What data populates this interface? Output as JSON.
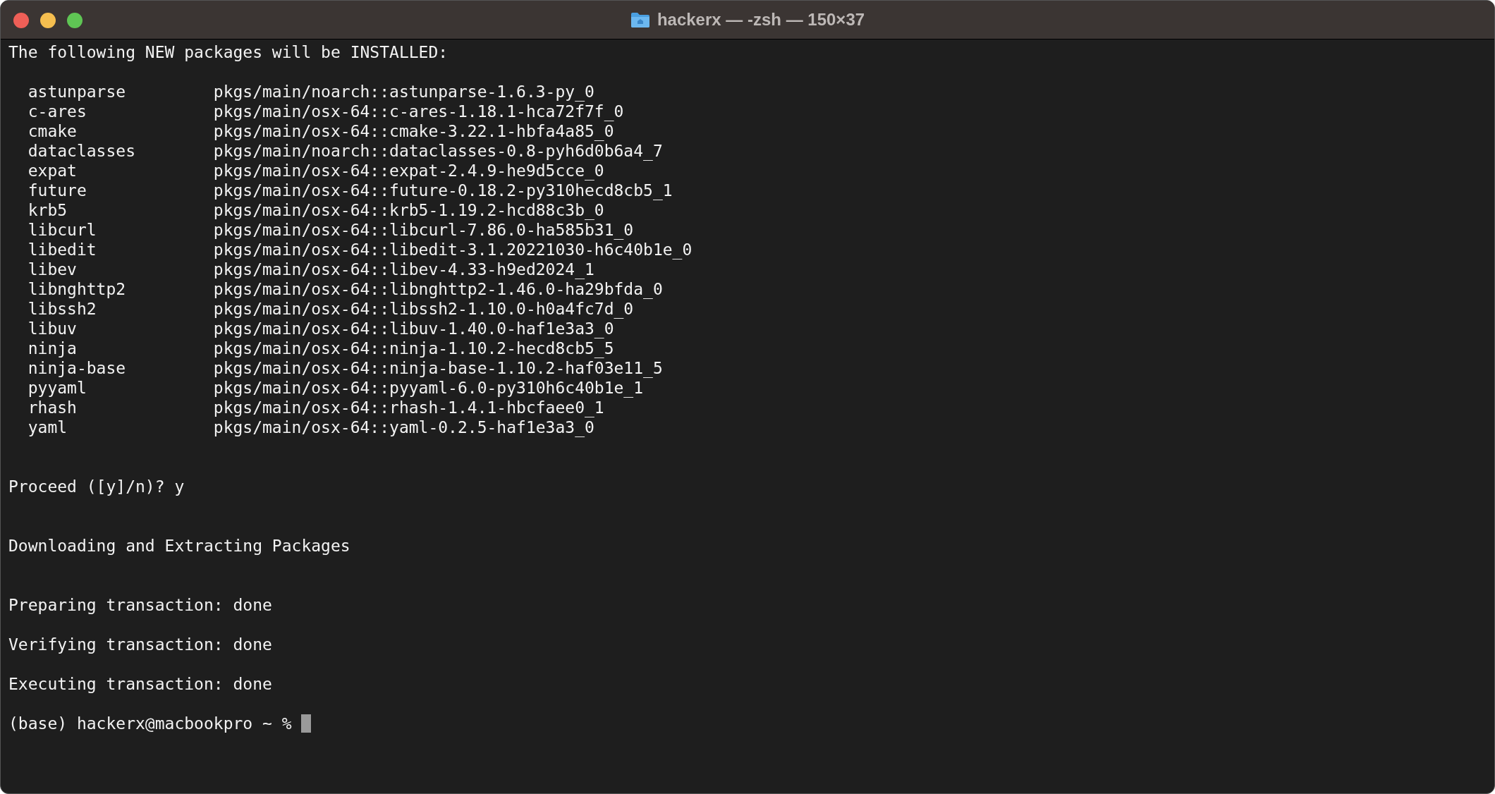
{
  "window": {
    "title": "hackerx — -zsh — 150×37"
  },
  "lines": [
    {
      "kind": "text",
      "text": "The following NEW packages will be INSTALLED:"
    },
    {
      "kind": "blank"
    },
    {
      "kind": "package",
      "name": "astunparse",
      "source": "pkgs/main/noarch::astunparse-1.6.3-py_0"
    },
    {
      "kind": "package",
      "name": "c-ares",
      "source": "pkgs/main/osx-64::c-ares-1.18.1-hca72f7f_0"
    },
    {
      "kind": "package",
      "name": "cmake",
      "source": "pkgs/main/osx-64::cmake-3.22.1-hbfa4a85_0"
    },
    {
      "kind": "package",
      "name": "dataclasses",
      "source": "pkgs/main/noarch::dataclasses-0.8-pyh6d0b6a4_7"
    },
    {
      "kind": "package",
      "name": "expat",
      "source": "pkgs/main/osx-64::expat-2.4.9-he9d5cce_0"
    },
    {
      "kind": "package",
      "name": "future",
      "source": "pkgs/main/osx-64::future-0.18.2-py310hecd8cb5_1"
    },
    {
      "kind": "package",
      "name": "krb5",
      "source": "pkgs/main/osx-64::krb5-1.19.2-hcd88c3b_0"
    },
    {
      "kind": "package",
      "name": "libcurl",
      "source": "pkgs/main/osx-64::libcurl-7.86.0-ha585b31_0"
    },
    {
      "kind": "package",
      "name": "libedit",
      "source": "pkgs/main/osx-64::libedit-3.1.20221030-h6c40b1e_0"
    },
    {
      "kind": "package",
      "name": "libev",
      "source": "pkgs/main/osx-64::libev-4.33-h9ed2024_1"
    },
    {
      "kind": "package",
      "name": "libnghttp2",
      "source": "pkgs/main/osx-64::libnghttp2-1.46.0-ha29bfda_0"
    },
    {
      "kind": "package",
      "name": "libssh2",
      "source": "pkgs/main/osx-64::libssh2-1.10.0-h0a4fc7d_0"
    },
    {
      "kind": "package",
      "name": "libuv",
      "source": "pkgs/main/osx-64::libuv-1.40.0-haf1e3a3_0"
    },
    {
      "kind": "package",
      "name": "ninja",
      "source": "pkgs/main/osx-64::ninja-1.10.2-hecd8cb5_5"
    },
    {
      "kind": "package",
      "name": "ninja-base",
      "source": "pkgs/main/osx-64::ninja-base-1.10.2-haf03e11_5"
    },
    {
      "kind": "package",
      "name": "pyyaml",
      "source": "pkgs/main/osx-64::pyyaml-6.0-py310h6c40b1e_1"
    },
    {
      "kind": "package",
      "name": "rhash",
      "source": "pkgs/main/osx-64::rhash-1.4.1-hbcfaee0_1"
    },
    {
      "kind": "package",
      "name": "yaml",
      "source": "pkgs/main/osx-64::yaml-0.2.5-haf1e3a3_0"
    },
    {
      "kind": "blank"
    },
    {
      "kind": "blank"
    },
    {
      "kind": "text",
      "text": "Proceed ([y]/n)? y"
    },
    {
      "kind": "blank"
    },
    {
      "kind": "blank"
    },
    {
      "kind": "text",
      "text": "Downloading and Extracting Packages"
    },
    {
      "kind": "blank"
    },
    {
      "kind": "blank"
    },
    {
      "kind": "text",
      "text": "Preparing transaction: done"
    },
    {
      "kind": "blank"
    },
    {
      "kind": "text",
      "text": "Verifying transaction: done"
    },
    {
      "kind": "blank"
    },
    {
      "kind": "text",
      "text": "Executing transaction: done"
    },
    {
      "kind": "blank"
    },
    {
      "kind": "prompt",
      "text": "(base) hackerx@macbookpro ~ %"
    }
  ]
}
